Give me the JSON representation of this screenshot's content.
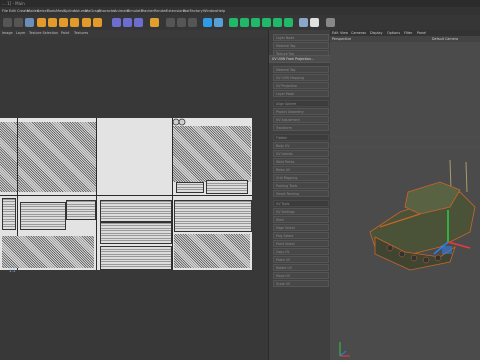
{
  "titlebar": {
    "text": "... 1] - Main"
  },
  "menubar": [
    "File",
    "Edit",
    "Create",
    "Modes",
    "Select",
    "Tools",
    "Mesh",
    "Spline",
    "Volume",
    "MoGraph",
    "Character",
    "Animate",
    "Simulate",
    "Tracker",
    "Render",
    "Extensions",
    "FlatFactory",
    "Window",
    "Help"
  ],
  "uv_toolbar": [
    "Image",
    "Layer",
    "Texture Selection",
    "Paint",
    "Textures"
  ],
  "corner_label": "1:1",
  "panel_rows": [
    "Layer Node",
    "Material Tag",
    "Texture Tag",
    "UV UVW From Projection...",
    "Material Tag",
    "UV UVW Mapping",
    "UV Projection",
    "Layer Mask",
    "Align Sphere",
    "Project Geometry",
    "UV Adjustment",
    "Transform",
    "Flatten",
    "Body UV",
    "UV Islands",
    "Weld Points",
    "Relax UV",
    "Grid Mapping",
    "Packing Tools",
    "Smart Packing",
    "UV Tools",
    "UV Settings",
    "Shell",
    "Edge Select",
    "Poly Select",
    "Point Select",
    "Copy UV",
    "Paste UV",
    "Rotate UV",
    "Move UV",
    "Scale UV"
  ],
  "panel_selected_index": 3,
  "viewport": {
    "menu": [
      "Edit",
      "View",
      "Cameras",
      "Display",
      "Options",
      "Filter",
      "Panel"
    ],
    "view_name": "Perspective",
    "camera_name": "Default Camera"
  },
  "colors": {
    "uv_background": "#e3e3e3",
    "uv_lines": "#2b2b2b",
    "accent": "#2e9be8"
  }
}
